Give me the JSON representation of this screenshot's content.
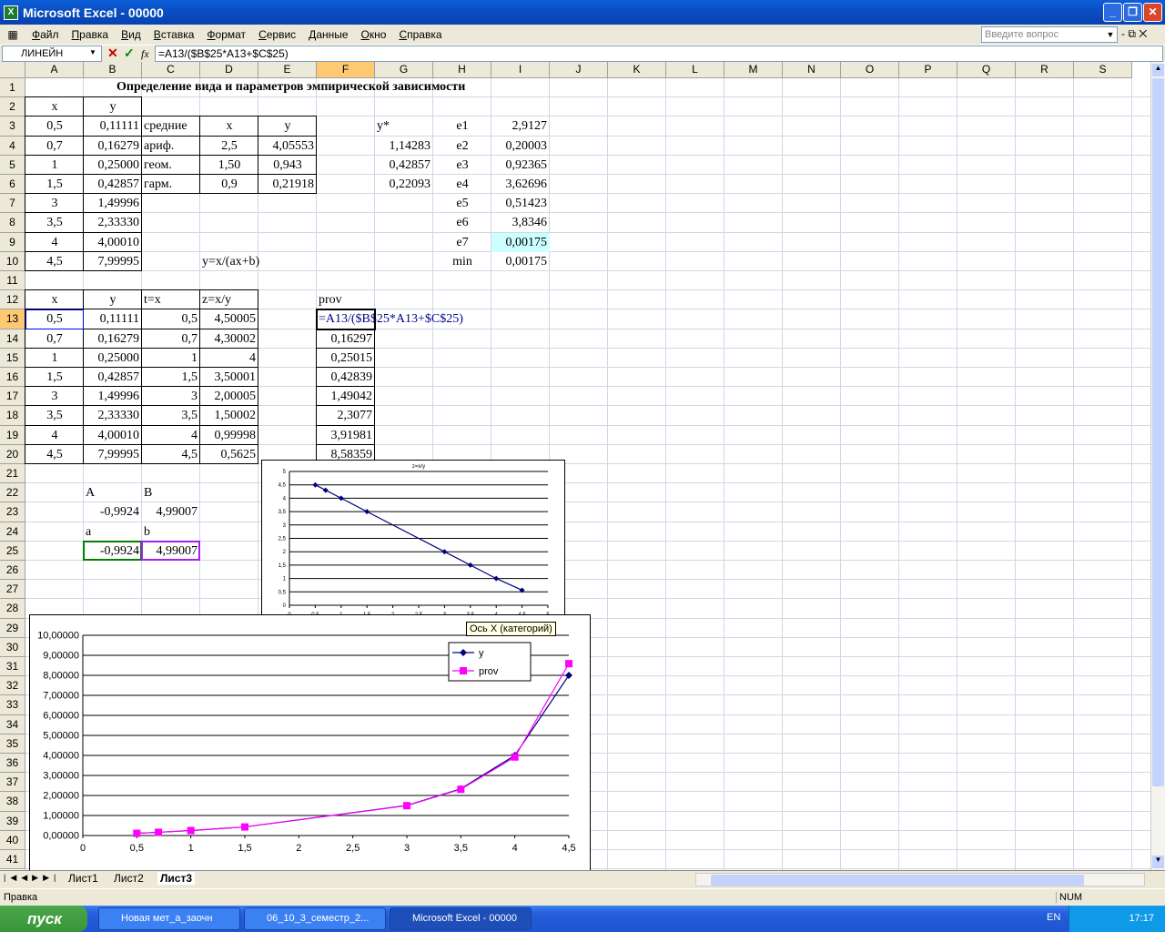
{
  "window": {
    "title": "Microsoft Excel - 00000"
  },
  "menu": {
    "items": [
      "Файл",
      "Правка",
      "Вид",
      "Вставка",
      "Формат",
      "Сервис",
      "Данные",
      "Окно",
      "Справка"
    ],
    "ask_placeholder": "Введите вопрос"
  },
  "formula_bar": {
    "name_box": "ЛИНЕЙН",
    "fx": "fx",
    "formula": "=A13/($B$25*A13+$C$25)"
  },
  "columns": [
    "A",
    "B",
    "C",
    "D",
    "E",
    "F",
    "G",
    "H",
    "I",
    "J",
    "K",
    "L",
    "M",
    "N",
    "O",
    "P",
    "Q",
    "R",
    "S"
  ],
  "rows": [
    "1",
    "2",
    "3",
    "4",
    "5",
    "6",
    "7",
    "8",
    "9",
    "10",
    "11",
    "12",
    "13",
    "14",
    "15",
    "16",
    "17",
    "18",
    "19",
    "20",
    "21",
    "22",
    "23",
    "24",
    "25",
    "26",
    "27",
    "28",
    "29",
    "30",
    "31",
    "32",
    "33",
    "34",
    "35",
    "36",
    "37",
    "38",
    "39",
    "40",
    "41"
  ],
  "cells": {
    "title": "Определение вида и параметров эмпирической зависимости",
    "hdr_x": "x",
    "hdr_y": "y",
    "x_vals": [
      "0,5",
      "0,7",
      "1",
      "1,5",
      "3",
      "3,5",
      "4",
      "4,5"
    ],
    "y_vals": [
      "0,11111",
      "0,16279",
      "0,25000",
      "0,42857",
      "1,49996",
      "2,33330",
      "4,00010",
      "7,99995"
    ],
    "means_label": "средние",
    "means_x": "x",
    "means_y": "y",
    "arith": "ариф.",
    "geom": "геом.",
    "harm": "гарм.",
    "arith_x": "2,5",
    "arith_y": "4,05553",
    "geom_x": "1,50",
    "geom_y": "0,943",
    "harm_x": "0,9",
    "harm_y": "0,21918",
    "ystar": "y*",
    "ystar_vals": [
      "1,14283",
      "0,42857",
      "0,22093"
    ],
    "e_labels": [
      "e1",
      "e2",
      "e3",
      "e4",
      "e5",
      "e6",
      "e7",
      "min"
    ],
    "e_vals": [
      "2,9127",
      "0,20003",
      "0,92365",
      "3,62696",
      "0,51423",
      "3,8346",
      "0,00175",
      "0,00175"
    ],
    "model": "y=x/(ax+b)",
    "t_hdr": "t=x",
    "z_hdr": "z=x/y",
    "prov_hdr": "prov",
    "t_vals": [
      "0,5",
      "0,7",
      "1",
      "1,5",
      "3",
      "3,5",
      "4",
      "4,5"
    ],
    "z_vals": [
      "4,50005",
      "4,30002",
      "4",
      "3,50001",
      "2,00005",
      "1,50002",
      "0,99998",
      "0,5625"
    ],
    "prov_vals": [
      "=A13/($B$25*A13+$C$25)",
      "0,16297",
      "0,25015",
      "0,42839",
      "1,49042",
      "2,3077",
      "3,91981",
      "8,58359"
    ],
    "A_lbl": "A",
    "B_lbl": "B",
    "A_val": "-0,9924",
    "B_val": "4,99007",
    "a_lbl": "a",
    "b_lbl": "b",
    "a_val": "-0,9924",
    "b_val": "4,99007"
  },
  "tooltip": "Ось X (категорий)",
  "sheets": [
    "Лист1",
    "Лист2",
    "Лист3"
  ],
  "status": {
    "left": "Правка",
    "num": "NUM"
  },
  "taskbar": {
    "start": "пуск",
    "tasks": [
      "Новая мет_а_заочн",
      "06_10_3_семестр_2...",
      "Microsoft Excel - 00000"
    ],
    "lang": "EN",
    "time": "17:17"
  },
  "chart_data": [
    {
      "type": "line",
      "title": "z=x/y",
      "x": [
        0.5,
        0.7,
        1,
        1.5,
        3,
        3.5,
        4,
        4.5
      ],
      "series": [
        {
          "values": [
            4.50005,
            4.30002,
            4,
            3.50001,
            2.00005,
            1.50002,
            0.99998,
            0.5625
          ],
          "color": "#000080"
        }
      ],
      "xlim": [
        0,
        5
      ],
      "ylim": [
        0,
        5
      ],
      "xticks": [
        "0",
        "0,5",
        "1",
        "1,5",
        "2",
        "2,5",
        "3",
        "3,5",
        "4",
        "4,5",
        "5"
      ],
      "yticks": [
        "0",
        "0,5",
        "1",
        "1,5",
        "2",
        "2,5",
        "3",
        "3,5",
        "4",
        "4,5",
        "5"
      ]
    },
    {
      "type": "line",
      "x": [
        0.5,
        0.7,
        1,
        1.5,
        3,
        3.5,
        4,
        4.5
      ],
      "series": [
        {
          "name": "y",
          "values": [
            0.11111,
            0.16279,
            0.25,
            0.42857,
            1.49996,
            2.3333,
            4.0001,
            7.99995
          ],
          "color": "#000080"
        },
        {
          "name": "prov",
          "values": [
            0.11111,
            0.16297,
            0.25015,
            0.42839,
            1.49042,
            2.3077,
            3.91981,
            8.58359
          ],
          "color": "#ff00ff"
        }
      ],
      "xlim": [
        0,
        4.5
      ],
      "ylim": [
        0,
        10
      ],
      "xticks": [
        "0",
        "0,5",
        "1",
        "1,5",
        "2",
        "2,5",
        "3",
        "3,5",
        "4",
        "4,5"
      ],
      "yticks": [
        "0,00000",
        "1,00000",
        "2,00000",
        "3,00000",
        "4,00000",
        "5,00000",
        "6,00000",
        "7,00000",
        "8,00000",
        "9,00000",
        "10,00000"
      ],
      "legend": "top-right"
    }
  ]
}
